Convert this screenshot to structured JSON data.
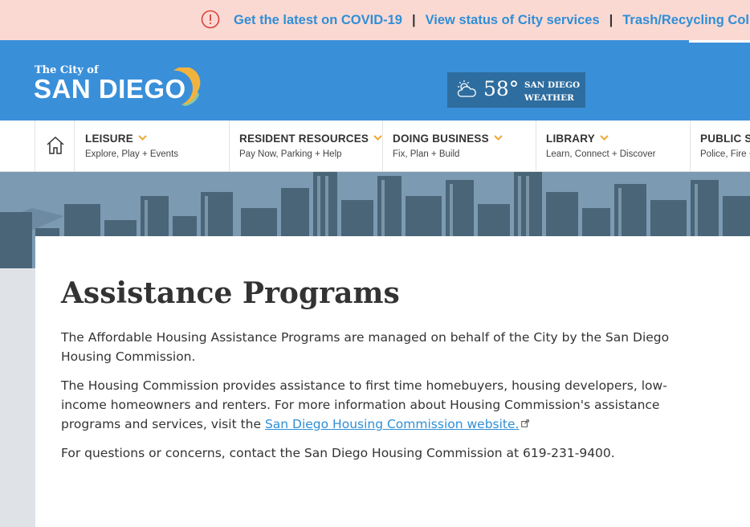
{
  "alert": {
    "links": [
      "Get the latest on COVID-19",
      "View status of City services",
      "Trash/Recycling Collection"
    ],
    "separator": "|"
  },
  "header": {
    "logo_small": "The City of",
    "logo_big": "SAN DIEGO",
    "weather": {
      "temp": "58°",
      "label": "SAN DIEGO WEATHER"
    }
  },
  "nav": {
    "items": [
      {
        "title": "LEISURE",
        "sub": "Explore, Play + Events"
      },
      {
        "title": "RESIDENT RESOURCES",
        "sub": "Pay Now, Parking + Help"
      },
      {
        "title": "DOING BUSINESS",
        "sub": "Fix, Plan + Build"
      },
      {
        "title": "LIBRARY",
        "sub": "Learn, Connect + Discover"
      },
      {
        "title": "PUBLIC SAFETY",
        "sub": "Police, Fire + Rescue"
      }
    ]
  },
  "content": {
    "title": "Assistance Programs",
    "p1": "The Affordable Housing Assistance Programs are managed on behalf of the City by the San Diego Housing Commission.",
    "p2_pre": "The Housing Commission provides assistance to first time homebuyers, housing developers, low-income homeowners and renters. For more information about Housing Commission's assistance programs and services, visit the ",
    "p2_link": "San Diego Housing Commission website.",
    "p3": "For questions or concerns, contact the San Diego Housing Commission at 619-231-9400."
  },
  "colors": {
    "alert_bg": "#fbd9d3",
    "header_bg": "#3a8fd9",
    "weather_bg": "#2e6d9f",
    "link": "#2f8fd6",
    "chevron": "#f0a830"
  }
}
